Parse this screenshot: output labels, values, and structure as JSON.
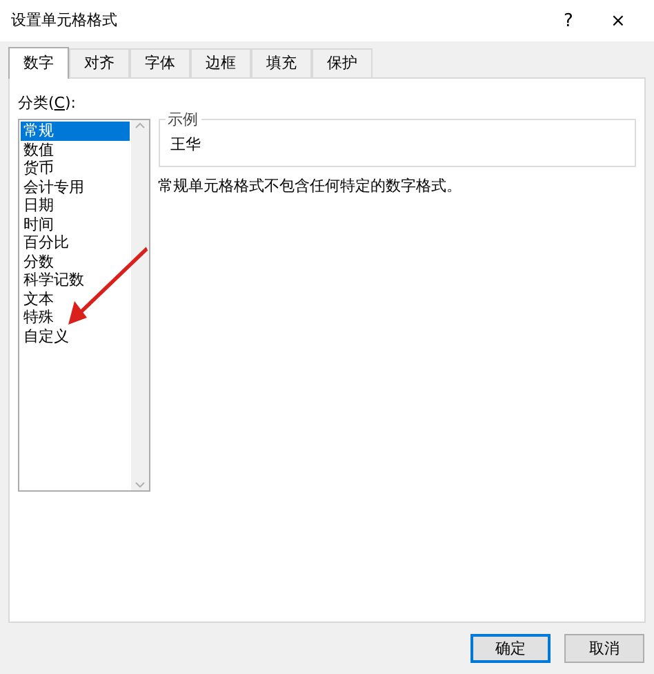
{
  "window": {
    "title": "设置单元格格式",
    "help": "?",
    "close": "×"
  },
  "tabs": [
    {
      "label": "数字",
      "selected": true
    },
    {
      "label": "对齐",
      "selected": false
    },
    {
      "label": "字体",
      "selected": false
    },
    {
      "label": "边框",
      "selected": false
    },
    {
      "label": "填充",
      "selected": false
    },
    {
      "label": "保护",
      "selected": false
    }
  ],
  "category": {
    "label": "分类(**C**):",
    "items": [
      {
        "label": "常规",
        "selected": true
      },
      {
        "label": "数值",
        "selected": false
      },
      {
        "label": "货币",
        "selected": false
      },
      {
        "label": "会计专用",
        "selected": false
      },
      {
        "label": "日期",
        "selected": false
      },
      {
        "label": "时间",
        "selected": false
      },
      {
        "label": "百分比",
        "selected": false
      },
      {
        "label": "分数",
        "selected": false
      },
      {
        "label": "科学记数",
        "selected": false
      },
      {
        "label": "文本",
        "selected": false
      },
      {
        "label": "特殊",
        "selected": false
      },
      {
        "label": "自定义",
        "selected": false
      }
    ]
  },
  "sample": {
    "legend": "示例",
    "value": "王华"
  },
  "description": "常规单元格格式不包含任何特定的数字格式。",
  "buttons": [
    {
      "label": "确定",
      "default": true
    },
    {
      "label": "取消",
      "default": false
    }
  ]
}
